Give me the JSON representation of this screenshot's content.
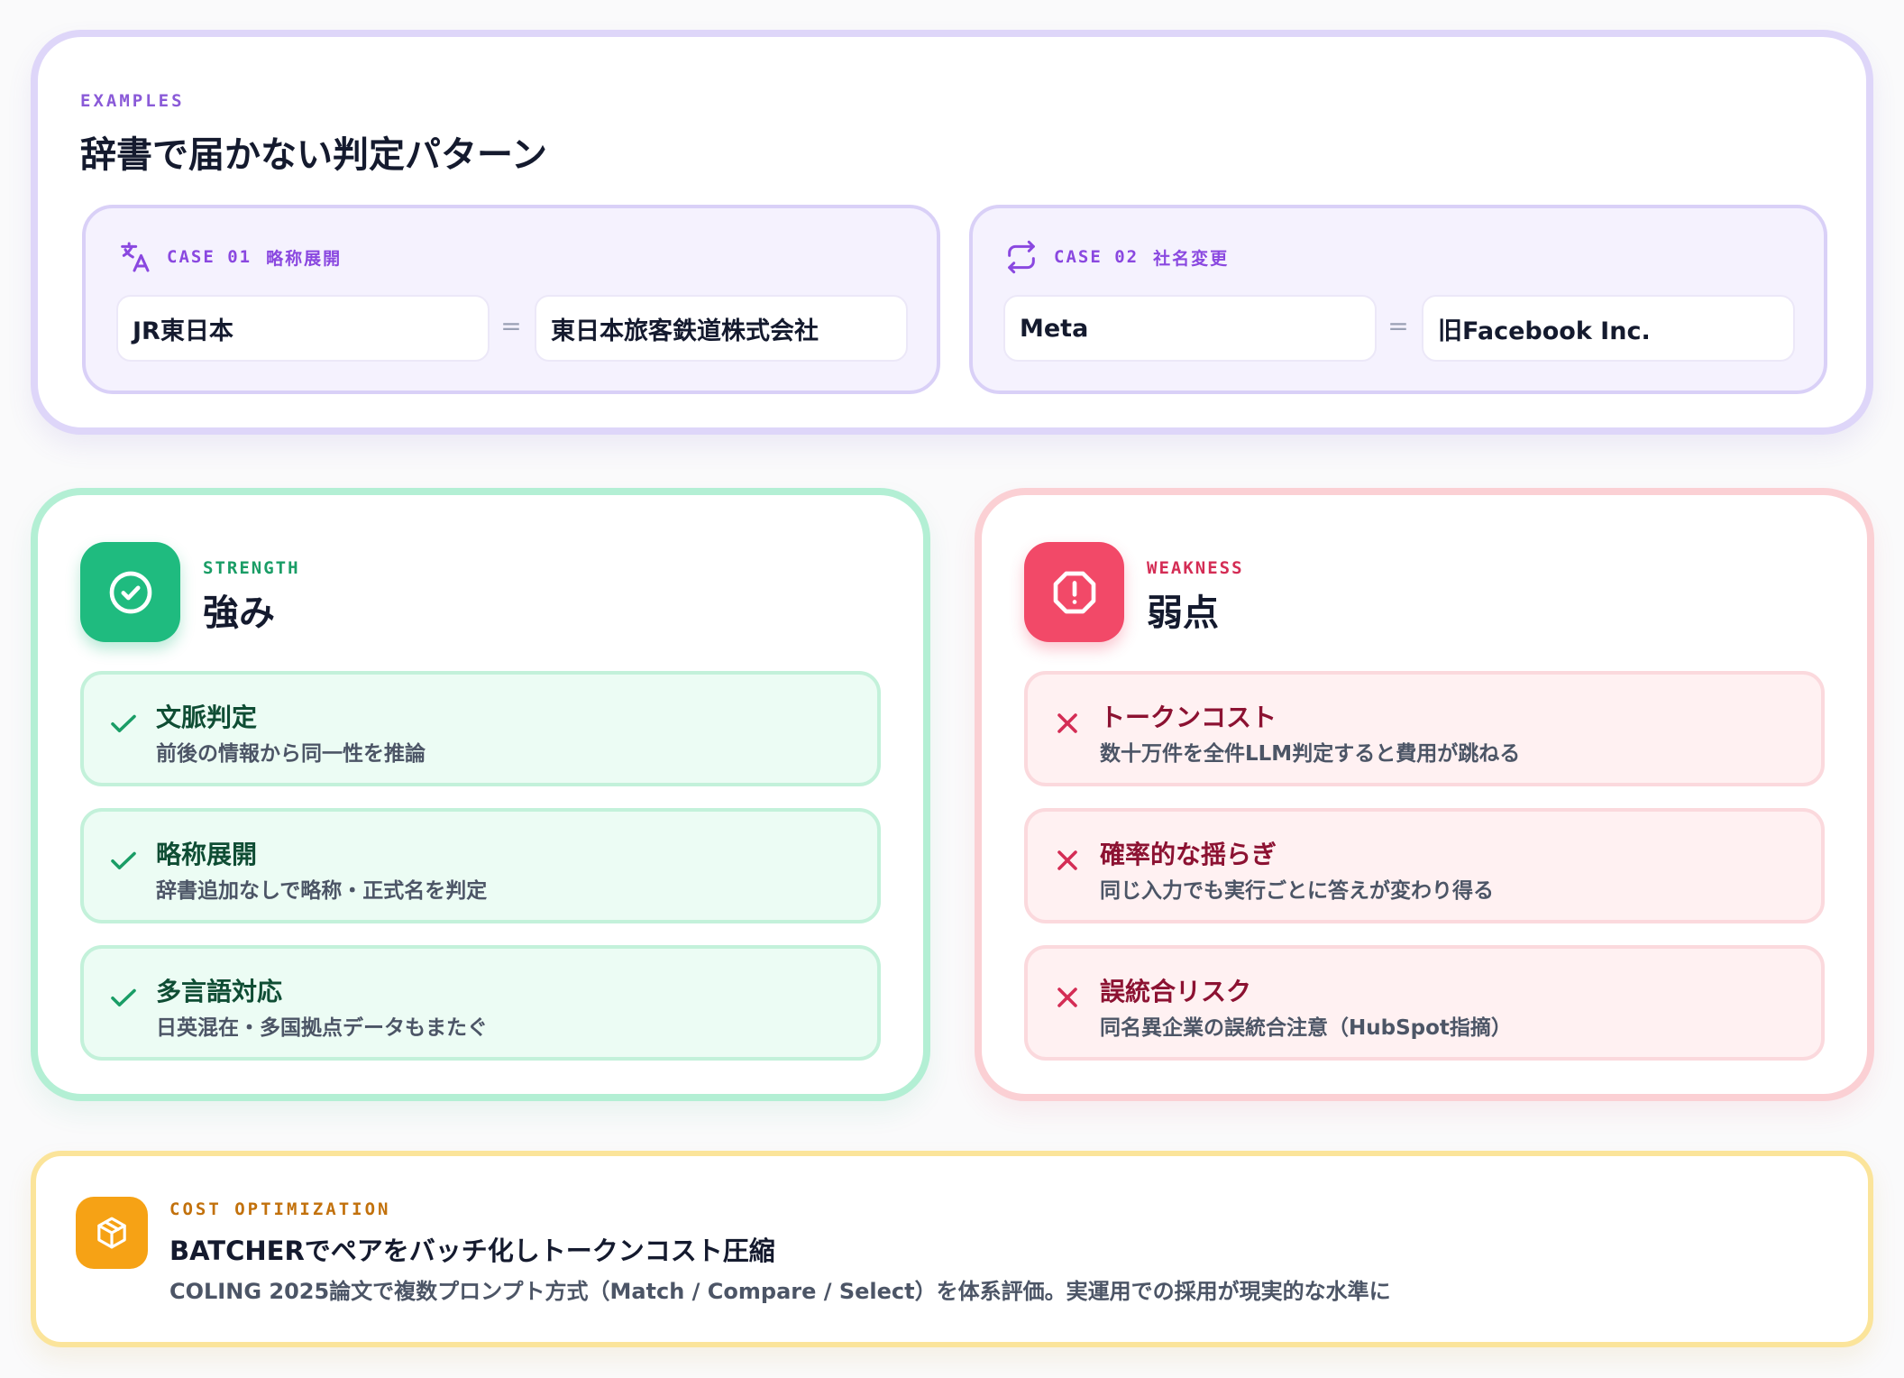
{
  "examples": {
    "eyebrow": "EXAMPLES",
    "title": "辞書で届かない判定パターン",
    "cases": [
      {
        "icon": "translate-icon",
        "label": "CASE 01",
        "tag": "略称展開",
        "left": "JR東日本",
        "equals": "=",
        "right": "東日本旅客鉄道株式会社"
      },
      {
        "icon": "repeat-icon",
        "label": "CASE 02",
        "tag": "社名変更",
        "left": "Meta",
        "equals": "=",
        "right": "旧Facebook Inc."
      }
    ]
  },
  "strength": {
    "eyebrow": "STRENGTH",
    "title": "強み",
    "items": [
      {
        "title": "文脈判定",
        "desc": "前後の情報から同一性を推論"
      },
      {
        "title": "略称展開",
        "desc": "辞書追加なしで略称・正式名を判定"
      },
      {
        "title": "多言語対応",
        "desc": "日英混在・多国拠点データもまたぐ"
      }
    ]
  },
  "weakness": {
    "eyebrow": "WEAKNESS",
    "title": "弱点",
    "items": [
      {
        "title": "トークンコスト",
        "desc": "数十万件を全件LLM判定すると費用が跳ねる"
      },
      {
        "title": "確率的な揺らぎ",
        "desc": "同じ入力でも実行ごとに答えが変わり得る"
      },
      {
        "title": "誤統合リスク",
        "desc": "同名異企業の誤統合注意（HubSpot指摘）"
      }
    ]
  },
  "cost": {
    "eyebrow": "COST OPTIMIZATION",
    "title": "BATCHERでペアをバッチ化しトークンコスト圧縮",
    "desc": "COLING 2025論文で複数プロンプト方式（Match / Compare / Select）を体系評価。実運用での採用が現実的な水準に"
  },
  "colors": {
    "purple_accent": "#8a48e0",
    "green_accent": "#1fbb7f",
    "red_accent": "#f24968",
    "amber_accent": "#f6a215"
  }
}
